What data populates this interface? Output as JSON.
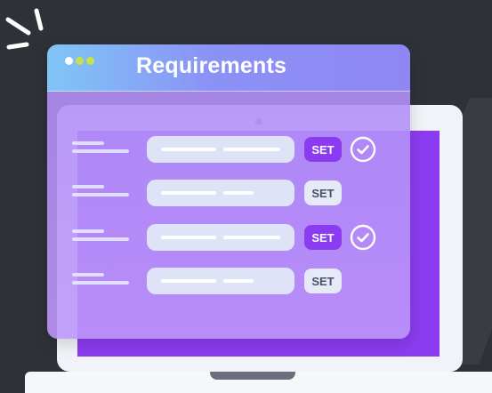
{
  "window": {
    "title": "Requirements"
  },
  "rows": [
    {
      "button_label": "SET",
      "active": true,
      "checked": true
    },
    {
      "button_label": "SET",
      "active": false,
      "checked": false
    },
    {
      "button_label": "SET",
      "active": true,
      "checked": true
    },
    {
      "button_label": "SET",
      "active": false,
      "checked": false
    }
  ],
  "icons": {
    "window_controls": "traffic-dots-icon",
    "check": "check-circle-icon",
    "burst": "sparkle-lines-icon"
  },
  "colors": {
    "background": "#2f3138",
    "accent": "#8b3cf0",
    "dot_1": "#ffffff",
    "dot_2": "#c6e24a",
    "dot_3": "#c6e24a"
  }
}
